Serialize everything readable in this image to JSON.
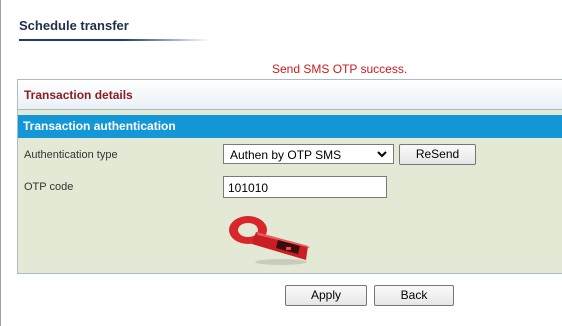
{
  "page": {
    "title": "Schedule transfer"
  },
  "status": {
    "message": "Send SMS OTP success."
  },
  "panel": {
    "details_title": "Transaction details",
    "auth_title": "Transaction authentication",
    "auth_type_label": "Authentication type",
    "auth_type_value": "Authen by OTP SMS",
    "resend_label": "ReSend",
    "otp_label": "OTP code",
    "otp_value": "101010"
  },
  "actions": {
    "apply_label": "Apply",
    "back_label": "Back"
  },
  "colors": {
    "accent_blue": "#1497d6",
    "title_red": "#8a1e22",
    "status_red": "#d0171d",
    "panel_bg": "#e4e9d6"
  },
  "icons": {
    "select_arrow": "chevron-down-icon",
    "token": "otp-token-device-icon"
  }
}
